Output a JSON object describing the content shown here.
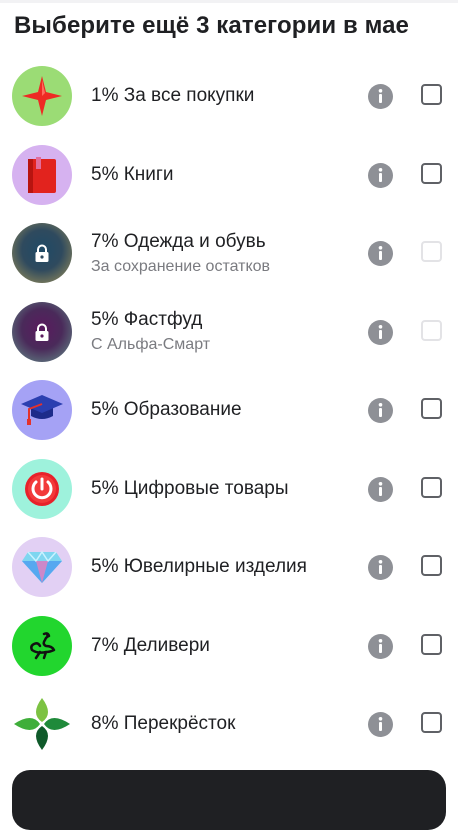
{
  "header": {
    "title": "Выберите ещё 3 категории в мае"
  },
  "colors": {
    "text": "#1f2023",
    "subtitle": "#7a7b80",
    "info": "#8e9096",
    "checkbox": "#5f6166"
  },
  "categories": [
    {
      "title": "1% За все покупки",
      "subtitle": "",
      "icon": "red-star-icon",
      "bg": "#9bdc75",
      "checkbox_enabled": true
    },
    {
      "title": "5% Книги",
      "subtitle": "",
      "icon": "red-book-icon",
      "bg": "#d6b2f0",
      "checkbox_enabled": true
    },
    {
      "title": "7% Одежда и обувь",
      "subtitle": "За сохранение остатков",
      "icon": "lock-icon",
      "bg": "#2f4a5e",
      "checkbox_enabled": false
    },
    {
      "title": "5% Фастфуд",
      "subtitle": "С Альфа-Смарт",
      "icon": "lock-icon",
      "bg": "#5a3a6e",
      "checkbox_enabled": false
    },
    {
      "title": "5% Образование",
      "subtitle": "",
      "icon": "graduation-cap-icon",
      "bg": "#a5a2f5",
      "checkbox_enabled": true
    },
    {
      "title": "5% Цифровые товары",
      "subtitle": "",
      "icon": "power-button-icon",
      "bg": "#9ef2dc",
      "checkbox_enabled": true
    },
    {
      "title": "5% Ювелирные изделия",
      "subtitle": "",
      "icon": "diamond-icon",
      "bg": "#e2d0f4",
      "checkbox_enabled": true
    },
    {
      "title": "7% Деливери",
      "subtitle": "",
      "icon": "ostrich-logo-icon",
      "bg": "#22d62e",
      "checkbox_enabled": true
    },
    {
      "title": "8% Перекрёсток",
      "subtitle": "",
      "icon": "clover-logo-icon",
      "bg": "#ffffff",
      "checkbox_enabled": true
    }
  ]
}
